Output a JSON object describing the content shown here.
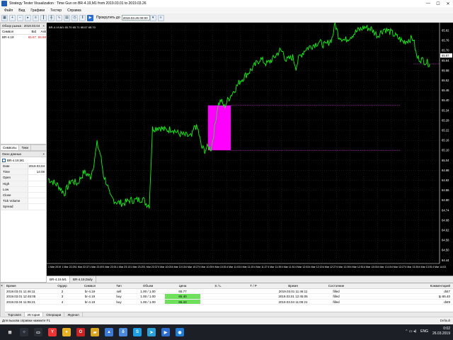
{
  "window": {
    "title": "Strategy Tester Visualization : Time Gun on BR-4.19,M1 from 2019.03.01 to 2019.03.26",
    "controls": [
      "—",
      "☐",
      "✕"
    ]
  },
  "menu": [
    "Файл",
    "Вид",
    "Графики",
    "Тестер",
    "Справка"
  ],
  "toolbar": {
    "skip_label": "Прокрутить до",
    "skip_date": "2019.03.26 00:00"
  },
  "market_watch": {
    "header": "Обзор рынка : 2019.03.04",
    "columns": [
      "Символ",
      "Bid",
      "Ask"
    ],
    "rows": [
      {
        "symbol": "BR-4.19",
        "bid": "65.67",
        "ask": "65.68"
      }
    ],
    "tabs": [
      "Символы",
      "Тики"
    ]
  },
  "data_window": {
    "header": "Окно данных",
    "symbol": "BR-4.19,M1",
    "rows": [
      {
        "label": "Date",
        "value": "2019.03.04"
      },
      {
        "label": "Time",
        "value": "14:08"
      },
      {
        "label": "Open",
        "value": ""
      },
      {
        "label": "High",
        "value": ""
      },
      {
        "label": "Low",
        "value": ""
      },
      {
        "label": "Close",
        "value": ""
      },
      {
        "label": "Tick Volume",
        "value": ""
      },
      {
        "label": "Spread",
        "value": ""
      }
    ]
  },
  "chart_data": {
    "type": "line",
    "symbol_label": "BR-4.19,M1 65.70 65.71 65.67 65.70",
    "y_ticks": [
      "65.82",
      "65.76",
      "65.70",
      "65.64",
      "65.58",
      "65.52",
      "65.46",
      "65.40",
      "65.34",
      "65.28",
      "65.22",
      "65.16",
      "65.10",
      "65.04",
      "64.98",
      "64.92",
      "64.86",
      "64.80",
      "64.74",
      "64.68",
      "64.62",
      "64.56",
      "64.50",
      "64.44"
    ],
    "ylim": [
      64.42,
      65.85
    ],
    "x_ticks": [
      "1 Mar 2019",
      "1 Mar 22:25",
      "1 Mar 22:37",
      "1 Mar 22:49",
      "1 Mar 23:01",
      "1 Mar 23:13",
      "1 Mar 23:25",
      "1 Mar 23:37",
      "4 Mar 10:03",
      "4 Mar 10:15",
      "4 Mar 10:27",
      "4 Mar 10:39",
      "4 Mar 10:51",
      "4 Mar 11:03",
      "4 Mar 11:15",
      "4 Mar 11:27",
      "4 Mar 11:39",
      "4 Mar 11:51",
      "4 Mar 12:03",
      "4 Mar 12:15",
      "4 Mar 12:27",
      "4 Mar 12:39",
      "4 Mar 12:51",
      "4 Mar 13:03",
      "4 Mar 13:15",
      "4 Mar 13:27",
      "4 Mar 13:39",
      "4 Mar 13:51",
      "4 Mar 14:03"
    ],
    "price_points": [
      [
        0,
        64.93
      ],
      [
        3,
        64.89
      ],
      [
        5,
        64.84
      ],
      [
        7,
        64.92
      ],
      [
        9,
        64.9
      ],
      [
        11,
        64.97
      ],
      [
        13,
        64.94
      ],
      [
        14,
        65.02
      ],
      [
        15,
        65.14
      ],
      [
        16,
        65.08
      ],
      [
        17,
        64.95
      ],
      [
        18,
        64.9
      ],
      [
        19,
        64.82
      ],
      [
        21,
        64.79
      ],
      [
        23,
        64.78
      ],
      [
        25,
        64.8
      ],
      [
        27,
        64.8
      ],
      [
        29,
        64.81
      ],
      [
        30,
        64.78
      ],
      [
        31,
        64.77
      ],
      [
        32,
        65.23
      ],
      [
        34,
        65.24
      ],
      [
        36,
        65.22
      ],
      [
        38,
        65.23
      ],
      [
        40,
        65.2
      ],
      [
        42,
        65.19
      ],
      [
        44,
        65.18
      ],
      [
        45,
        65.25
      ],
      [
        46,
        65.22
      ],
      [
        47,
        65.12
      ],
      [
        48,
        65.1
      ],
      [
        49,
        65.12
      ],
      [
        50,
        65.11
      ],
      [
        51,
        65.23
      ],
      [
        52,
        65.37
      ],
      [
        53,
        65.4
      ],
      [
        54,
        65.36
      ],
      [
        55,
        65.4
      ],
      [
        57,
        65.46
      ],
      [
        59,
        65.52
      ],
      [
        61,
        65.56
      ],
      [
        63,
        65.6
      ],
      [
        65,
        65.65
      ],
      [
        67,
        65.62
      ],
      [
        69,
        65.65
      ],
      [
        71,
        65.7
      ],
      [
        72,
        65.69
      ],
      [
        73,
        65.64
      ],
      [
        75,
        65.66
      ],
      [
        76,
        65.6
      ],
      [
        77,
        65.66
      ],
      [
        79,
        65.71
      ],
      [
        81,
        65.73
      ],
      [
        83,
        65.75
      ],
      [
        85,
        65.73
      ],
      [
        87,
        65.77
      ],
      [
        88,
        65.86
      ],
      [
        89,
        65.79
      ],
      [
        91,
        65.76
      ],
      [
        93,
        65.79
      ],
      [
        95,
        65.82
      ],
      [
        97,
        65.84
      ],
      [
        99,
        65.83
      ],
      [
        101,
        65.79
      ],
      [
        103,
        65.83
      ],
      [
        105,
        65.81
      ],
      [
        107,
        65.78
      ],
      [
        109,
        65.75
      ],
      [
        111,
        65.77
      ],
      [
        112,
        65.77
      ],
      [
        113,
        65.66
      ],
      [
        115,
        65.64
      ],
      [
        117,
        65.62
      ]
    ],
    "x_max": 117,
    "highlight": {
      "x_start": 49,
      "x_end": 56,
      "y_low": 65.1,
      "y_high": 65.37,
      "color": "#ff00ff"
    },
    "levels": [
      {
        "value": 65.37,
        "x_start": 56,
        "x_end": 108
      },
      {
        "value": 65.1,
        "x_start": 56,
        "x_end": 108
      },
      {
        "value": 65.62,
        "x_start": 112,
        "x_end": 120
      }
    ],
    "current_price": "65.67",
    "line_color": "#00ff00",
    "background": "#000000",
    "grid": true,
    "tabs": [
      "BR-4.19,M1",
      "BR-4.19,Daily"
    ]
  },
  "trades": {
    "columns": [
      "Время",
      "Ордер",
      "Символ",
      "Тип",
      "Объем",
      "Цена",
      "S / L",
      "T / P",
      "Время",
      "Состояние",
      "Комментарий"
    ],
    "rows": [
      {
        "time": "2019.03.01 11:46:11",
        "order": "2",
        "symbol": "br-4.19",
        "type": "sell",
        "volume": "1.00 / 1.00",
        "price": "65.77",
        "sl": "",
        "tp": "",
        "time2": "2019.03.01 11:46:11",
        "state": "filled",
        "comment": "dt47",
        "green": false
      },
      {
        "time": "2019.03.01 12:45:05",
        "order": "3",
        "symbol": "br-4.19",
        "type": "buy",
        "volume": "1.00 / 1.00",
        "price": "65.40",
        "sl": "",
        "tp": "",
        "time2": "2019.03.01 12:45:05",
        "state": "filled",
        "comment": "tp 65.40",
        "green": true
      },
      {
        "time": "2019.03.04 11:06:21",
        "order": "4",
        "symbol": "br-4.19",
        "type": "buy",
        "volume": "1.00 / 1.00",
        "price": "65.43",
        "sl": "",
        "tp": "",
        "time2": "2019.03.04 11:06:21",
        "state": "filled",
        "comment": "dt49",
        "green": true
      }
    ],
    "tabs": [
      "Торговля",
      "История",
      "Операции",
      "Журнал"
    ]
  },
  "status": {
    "left": "Для вызова справки нажмите F1",
    "right": "Default"
  },
  "taskbar": {
    "lang": "ENG",
    "time": "0:02",
    "date": "26.03.2019"
  }
}
